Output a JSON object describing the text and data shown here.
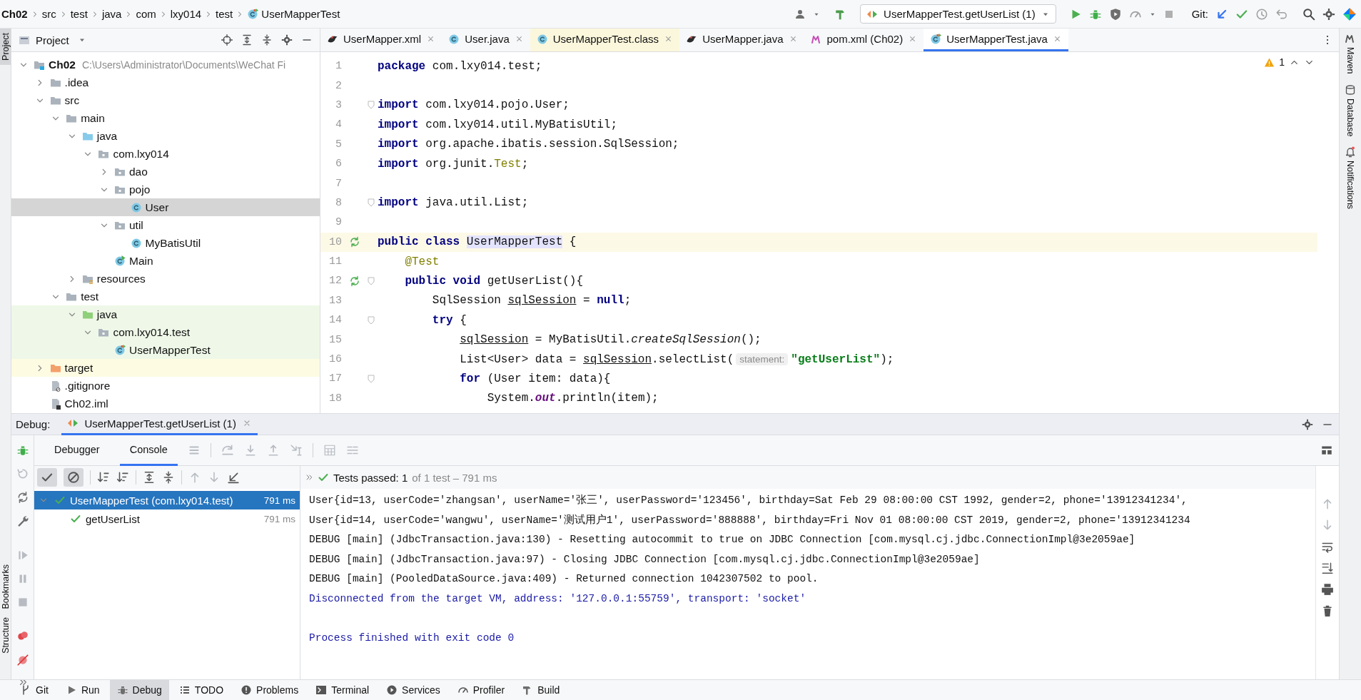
{
  "breadcrumbs": [
    {
      "label": "Ch02",
      "kind": "module"
    },
    {
      "label": "src",
      "kind": "folder"
    },
    {
      "label": "test",
      "kind": "folder"
    },
    {
      "label": "java",
      "kind": "folder"
    },
    {
      "label": "com",
      "kind": "folder"
    },
    {
      "label": "lxy014",
      "kind": "folder"
    },
    {
      "label": "test",
      "kind": "folder"
    },
    {
      "label": "UserMapperTest",
      "kind": "class-test"
    }
  ],
  "run_config": {
    "label": "UserMapperTest.getUserList (1)"
  },
  "git_label": "Git:",
  "left_stripe": {
    "top": [
      {
        "label": "Project",
        "selected": true
      }
    ],
    "bottom": [
      {
        "label": "Bookmarks",
        "selected": false
      },
      {
        "label": "Structure",
        "selected": false
      }
    ]
  },
  "right_stripe": [
    {
      "label": "Maven",
      "kind": "maven"
    },
    {
      "label": "Database",
      "kind": "database"
    },
    {
      "label": "Notifications",
      "kind": "notifications"
    }
  ],
  "project_panel": {
    "title": "Project"
  },
  "editor_tabs": [
    {
      "label": "UserMapper.xml",
      "kind": "mybatis",
      "selected": false,
      "external": false
    },
    {
      "label": "User.java",
      "kind": "class",
      "selected": false,
      "external": false
    },
    {
      "label": "UserMapperTest.class",
      "kind": "class",
      "selected": false,
      "external": true
    },
    {
      "label": "UserMapper.java",
      "kind": "mybatis",
      "selected": false,
      "external": false
    },
    {
      "label": "pom.xml (Ch02)",
      "kind": "maven",
      "selected": false,
      "external": false
    },
    {
      "label": "UserMapperTest.java",
      "kind": "class-test",
      "selected": true,
      "external": false
    }
  ],
  "tree": [
    {
      "label": "Ch02",
      "kind": "module",
      "path": "C:\\Users\\Administrator\\Documents\\WeChat Fi",
      "expanded": true,
      "selected": false,
      "children": [
        {
          "label": ".idea",
          "kind": "folder",
          "expanded": false,
          "selected": false
        },
        {
          "label": "src",
          "kind": "folder",
          "expanded": true,
          "selected": false,
          "children": [
            {
              "label": "main",
              "kind": "folder",
              "expanded": true,
              "selected": false,
              "children": [
                {
                  "label": "java",
                  "kind": "source-folder",
                  "expanded": true,
                  "selected": false,
                  "children": [
                    {
                      "label": "com.lxy014",
                      "kind": "package",
                      "expanded": true,
                      "selected": false,
                      "children": [
                        {
                          "label": "dao",
                          "kind": "package",
                          "expanded": false,
                          "selected": false
                        },
                        {
                          "label": "pojo",
                          "kind": "package",
                          "expanded": true,
                          "selected": false,
                          "children": [
                            {
                              "label": "User",
                              "kind": "class",
                              "selected": true
                            }
                          ]
                        },
                        {
                          "label": "util",
                          "kind": "package",
                          "expanded": true,
                          "selected": false,
                          "children": [
                            {
                              "label": "MyBatisUtil",
                              "kind": "class",
                              "selected": false
                            }
                          ]
                        },
                        {
                          "label": "Main",
                          "kind": "class-main",
                          "selected": false
                        }
                      ]
                    }
                  ]
                },
                {
                  "label": "resources",
                  "kind": "resources",
                  "expanded": false,
                  "selected": false
                }
              ]
            },
            {
              "label": "test",
              "kind": "folder",
              "expanded": true,
              "selected": false,
              "children": [
                {
                  "label": "java",
                  "kind": "test-folder",
                  "expanded": true,
                  "selected": false,
                  "test_source": true,
                  "children": [
                    {
                      "label": "com.lxy014.test",
                      "kind": "package",
                      "expanded": true,
                      "selected": false,
                      "test_source": true,
                      "children": [
                        {
                          "label": "UserMapperTest",
                          "kind": "class-test",
                          "selected": false,
                          "test_source": true
                        }
                      ]
                    }
                  ]
                }
              ]
            }
          ]
        },
        {
          "label": "target",
          "kind": "excluded-folder",
          "expanded": false,
          "selected": false,
          "excluded": true
        },
        {
          "label": ".gitignore",
          "kind": "ignore-file",
          "selected": false
        },
        {
          "label": "Ch02.iml",
          "kind": "iml-file",
          "selected": false
        }
      ]
    }
  ],
  "editor": {
    "warnings": "1",
    "lines": [
      {
        "number": "1",
        "current": false,
        "run": false,
        "fold": false,
        "segments": [
          {
            "text": "package",
            "kind": "keyword"
          },
          {
            "text": " com.lxy014.test;",
            "kind": "plain"
          }
        ]
      },
      {
        "number": "2",
        "current": false,
        "run": false,
        "fold": false
      },
      {
        "number": "3",
        "current": false,
        "run": false,
        "fold": true,
        "segments": [
          {
            "text": "import",
            "kind": "keyword"
          },
          {
            "text": " com.lxy014.pojo.User;",
            "kind": "plain"
          }
        ]
      },
      {
        "number": "4",
        "current": false,
        "run": false,
        "fold": false,
        "segments": [
          {
            "text": "import",
            "kind": "keyword"
          },
          {
            "text": " com.lxy014.util.MyBatisUtil;",
            "kind": "plain"
          }
        ]
      },
      {
        "number": "5",
        "current": false,
        "run": false,
        "fold": false,
        "segments": [
          {
            "text": "import",
            "kind": "keyword"
          },
          {
            "text": " org.apache.ibatis.session.SqlSession;",
            "kind": "plain"
          }
        ]
      },
      {
        "number": "6",
        "current": false,
        "run": false,
        "fold": false,
        "segments": [
          {
            "text": "import",
            "kind": "keyword"
          },
          {
            "text": " org.junit.",
            "kind": "plain"
          },
          {
            "text": "Test",
            "kind": "annotation"
          },
          {
            "text": ";",
            "kind": "plain"
          }
        ]
      },
      {
        "number": "7",
        "current": false,
        "run": false,
        "fold": false
      },
      {
        "number": "8",
        "current": false,
        "run": false,
        "fold": true,
        "segments": [
          {
            "text": "import",
            "kind": "keyword"
          },
          {
            "text": " java.util.List;",
            "kind": "plain"
          }
        ]
      },
      {
        "number": "9",
        "current": false,
        "run": false,
        "fold": false
      },
      {
        "number": "10",
        "current": true,
        "run": true,
        "fold": false,
        "segments": [
          {
            "text": "public class ",
            "kind": "keyword"
          },
          {
            "text": "UserMapperTest",
            "kind": "highlight"
          },
          {
            "text": " {",
            "kind": "plain"
          }
        ]
      },
      {
        "number": "11",
        "current": false,
        "run": false,
        "fold": false,
        "segments": [
          {
            "text": "    @Test",
            "kind": "annotation"
          }
        ]
      },
      {
        "number": "12",
        "current": false,
        "run": true,
        "fold": true,
        "segments": [
          {
            "text": "    public void",
            "kind": "keyword"
          },
          {
            "text": " getUserList(){",
            "kind": "plain"
          }
        ]
      },
      {
        "number": "13",
        "current": false,
        "run": false,
        "fold": false,
        "segments": [
          {
            "text": "        SqlSession ",
            "kind": "plain"
          },
          {
            "text": "sqlSession",
            "kind": "variable"
          },
          {
            "text": " = ",
            "kind": "plain"
          },
          {
            "text": "null",
            "kind": "keyword"
          },
          {
            "text": ";",
            "kind": "plain"
          }
        ]
      },
      {
        "number": "14",
        "current": false,
        "run": false,
        "fold": true,
        "segments": [
          {
            "text": "        try",
            "kind": "keyword"
          },
          {
            "text": " {",
            "kind": "plain"
          }
        ]
      },
      {
        "number": "15",
        "current": false,
        "run": false,
        "fold": false,
        "segments": [
          {
            "text": "            sqlSession",
            "kind": "variable"
          },
          {
            "text": " = MyBatisUtil.",
            "kind": "plain"
          },
          {
            "text": "createSqlSession",
            "kind": "italic"
          },
          {
            "text": "();",
            "kind": "plain"
          }
        ]
      },
      {
        "number": "16",
        "current": false,
        "run": false,
        "fold": false,
        "segments": [
          {
            "text": "            List<User> data = ",
            "kind": "plain"
          },
          {
            "text": "sqlSession",
            "kind": "variable"
          },
          {
            "text": ".selectList(",
            "kind": "plain"
          },
          {
            "text": "statement:",
            "kind": "hint"
          },
          {
            "text": "\"getUserList\"",
            "kind": "string"
          },
          {
            "text": ");",
            "kind": "plain"
          }
        ]
      },
      {
        "number": "17",
        "current": false,
        "run": false,
        "fold": true,
        "segments": [
          {
            "text": "            for",
            "kind": "keyword"
          },
          {
            "text": " (User item: data){",
            "kind": "plain"
          }
        ]
      },
      {
        "number": "18",
        "current": false,
        "run": false,
        "fold": false,
        "segments": [
          {
            "text": "                System.",
            "kind": "plain"
          },
          {
            "text": "out",
            "kind": "static"
          },
          {
            "text": ".println(item);",
            "kind": "plain"
          }
        ]
      }
    ]
  },
  "debug": {
    "label": "Debug:",
    "session_tab": {
      "label": "UserMapperTest.getUserList (1)",
      "selected": true
    },
    "tabs": [
      {
        "label": "Debugger",
        "selected": false
      },
      {
        "label": "Console",
        "selected": true
      }
    ],
    "filters": [
      {
        "kind": "passed",
        "on": true
      },
      {
        "kind": "ignored",
        "on": true
      }
    ],
    "status_passed": "Tests passed: 1",
    "status_detail": "of 1 test – 791 ms",
    "test_tree": [
      {
        "label": "UserMapperTest (com.lxy014.test)",
        "time": "791 ms",
        "passed": true,
        "expanded": true,
        "selected": true,
        "children": [
          {
            "label": "getUserList",
            "time": "791 ms",
            "passed": true,
            "selected": false
          }
        ]
      }
    ],
    "console": [
      {
        "kind": "output",
        "text": "User{id=13, userCode='zhangsan', userName='张三', userPassword='123456', birthday=Sat Feb 29 08:00:00 CST 1992, gender=2, phone='13912341234',"
      },
      {
        "kind": "output",
        "text": "User{id=14, userCode='wangwu', userName='测试用户1', userPassword='888888', birthday=Fri Nov 01 08:00:00 CST 2019, gender=2, phone='13912341234"
      },
      {
        "kind": "output",
        "text": "DEBUG [main] (JdbcTransaction.java:130) - Resetting autocommit to true on JDBC Connection [com.mysql.cj.jdbc.ConnectionImpl@3e2059ae]"
      },
      {
        "kind": "output",
        "text": "DEBUG [main] (JdbcTransaction.java:97) - Closing JDBC Connection [com.mysql.cj.jdbc.ConnectionImpl@3e2059ae]"
      },
      {
        "kind": "output",
        "text": "DEBUG [main] (PooledDataSource.java:409) - Returned connection 1042307502 to pool."
      },
      {
        "kind": "system",
        "text": "Disconnected from the target VM, address: '127.0.0.1:55759', transport: 'socket'"
      },
      {
        "kind": "exit",
        "text": "Process finished with exit code 0"
      }
    ]
  },
  "bottom_tabs": [
    {
      "label": "Git",
      "kind": "git",
      "selected": false
    },
    {
      "label": "Run",
      "kind": "run",
      "selected": false
    },
    {
      "label": "Debug",
      "kind": "debug",
      "selected": true
    },
    {
      "label": "TODO",
      "kind": "todo",
      "selected": false
    },
    {
      "label": "Problems",
      "kind": "problems",
      "selected": false
    },
    {
      "label": "Terminal",
      "kind": "terminal",
      "selected": false
    },
    {
      "label": "Services",
      "kind": "services",
      "selected": false
    },
    {
      "label": "Profiler",
      "kind": "profiler",
      "selected": false
    },
    {
      "label": "Build",
      "kind": "build",
      "selected": false
    }
  ]
}
